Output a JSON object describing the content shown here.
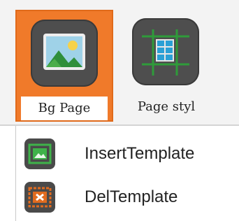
{
  "ribbon": {
    "buttons": [
      {
        "label": "Bg Page",
        "icon": "landscape-image-icon",
        "state": "selected"
      },
      {
        "label": "Page styl",
        "icon": "grid-layout-icon"
      }
    ]
  },
  "menu": {
    "items": [
      {
        "label": "InsertTemplate",
        "icon": "insert-template-icon"
      },
      {
        "label": "DelTemplate",
        "icon": "delete-template-icon"
      }
    ]
  },
  "colors": {
    "selected_accent": "#f07a2a",
    "icon_bg": "#4e4e4e",
    "green_accent": "#2f9b3a",
    "orange_accent": "#e06b1f"
  }
}
